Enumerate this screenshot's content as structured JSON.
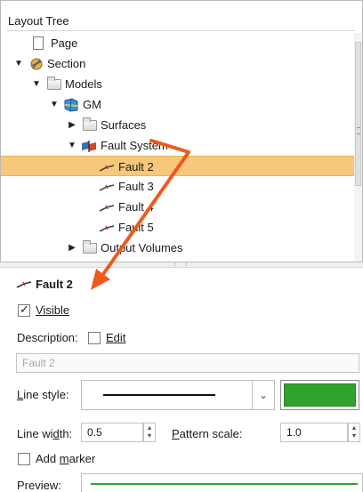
{
  "tree": {
    "header": "Layout Tree",
    "items": [
      {
        "label": "Page",
        "icon": "page-icon"
      },
      {
        "label": "Section",
        "icon": "section-icon"
      },
      {
        "label": "Models",
        "icon": "folder-icon"
      },
      {
        "label": "GM",
        "icon": "geological-model-icon"
      },
      {
        "label": "Surfaces",
        "icon": "folder-icon"
      },
      {
        "label": "Fault System",
        "icon": "fault-system-icon"
      },
      {
        "label": "Fault 2",
        "icon": "fault-icon",
        "selected": true
      },
      {
        "label": "Fault 3",
        "icon": "fault-icon"
      },
      {
        "label": "Fault 4",
        "icon": "fault-icon"
      },
      {
        "label": "Fault 5",
        "icon": "fault-icon"
      },
      {
        "label": "Output Volumes",
        "icon": "folder-icon"
      }
    ]
  },
  "properties": {
    "title": "Fault 2",
    "visible_label": "Visible",
    "visible_checked": true,
    "description_label": "Description:",
    "edit_label": "Edit",
    "edit_checked": false,
    "name_value": "Fault 2",
    "line_style_label": "Line style:",
    "line_color": "#2ea42c",
    "line_width_label": "Line width:",
    "line_width_value": "0.5",
    "pattern_scale_label": "Pattern scale:",
    "pattern_scale_value": "1.0",
    "add_marker_label": "Add marker",
    "add_marker_checked": false,
    "preview_label": "Preview:"
  },
  "colors": {
    "selection": "#f7c77b",
    "annotation_arrow": "#ef5a1c",
    "line_green": "#2ea42c"
  }
}
